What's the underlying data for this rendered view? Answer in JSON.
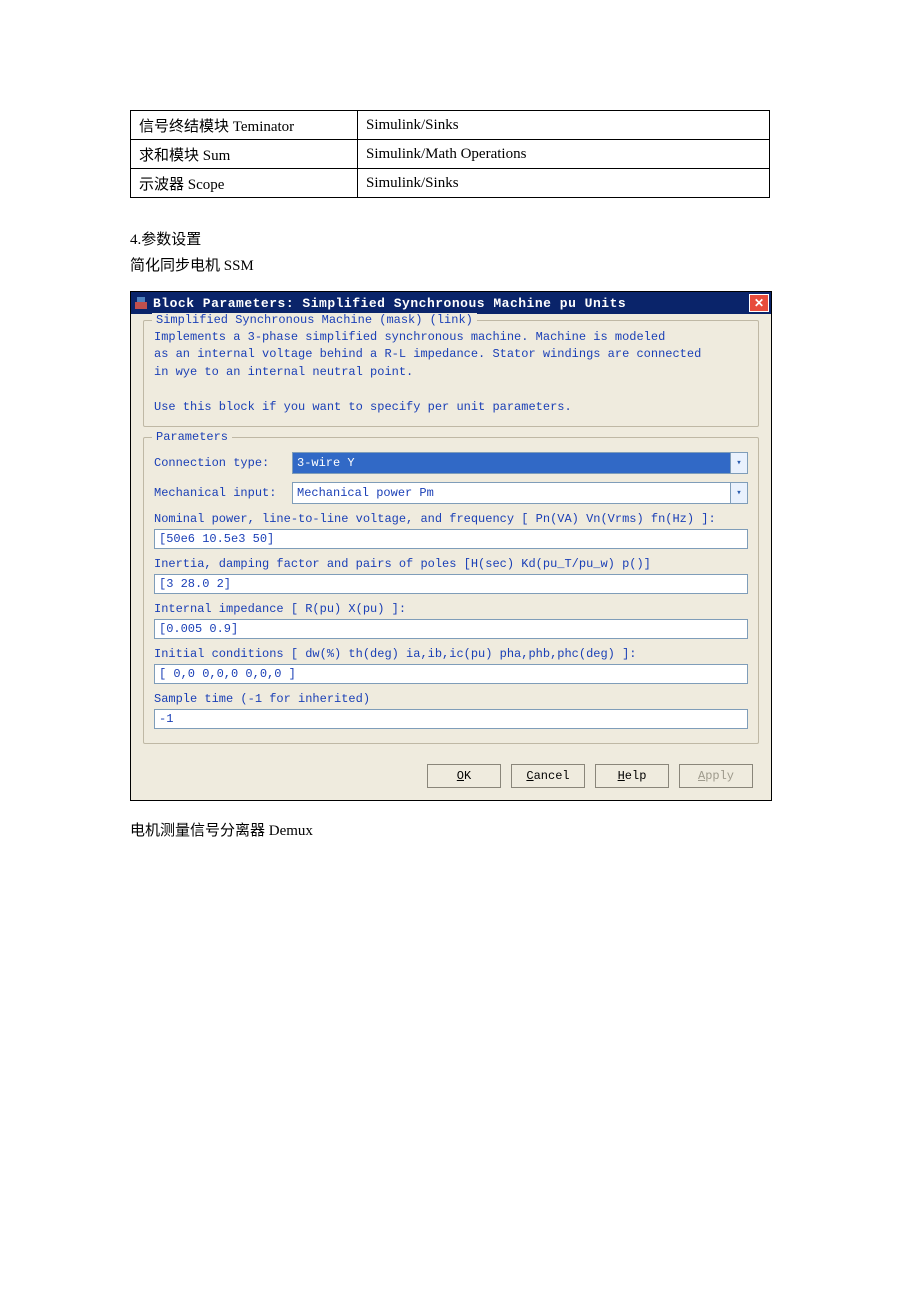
{
  "table": {
    "rows": [
      [
        "信号终结模块 Teminator",
        "Simulink/Sinks"
      ],
      [
        "求和模块 Sum",
        "Simulink/Math Operations"
      ],
      [
        "示波器 Scope",
        "Simulink/Sinks"
      ]
    ]
  },
  "section": {
    "line1": "4.参数设置",
    "line2": "简化同步电机 SSM"
  },
  "dialog": {
    "title": "Block Parameters: Simplified Synchronous Machine pu Units",
    "mask_title": "Simplified Synchronous Machine (mask) (link)",
    "description": "Implements a 3-phase simplified synchronous machine. Machine is modeled\nas an internal voltage behind a R-L impedance. Stator windings are connected\nin wye to an internal neutral point.\n\nUse this block if you want to specify per unit parameters.",
    "params_title": "Parameters",
    "connection": {
      "label": "Connection type:",
      "value": "3-wire Y"
    },
    "mechanical": {
      "label": "Mechanical input:",
      "value": "Mechanical power Pm"
    },
    "nominal": {
      "label": "Nominal power, line-to-line voltage, and frequency [ Pn(VA) Vn(Vrms) fn(Hz) ]:",
      "value": "[50e6 10.5e3 50]"
    },
    "inertia": {
      "label": "Inertia, damping factor and pairs of poles [H(sec) Kd(pu_T/pu_w) p()]",
      "value": "[3 28.0 2]"
    },
    "impedance": {
      "label": "Internal impedance [ R(pu)  X(pu) ]:",
      "value": "[0.005  0.9]"
    },
    "initial": {
      "label": "Initial conditions [ dw(%)  th(deg)  ia,ib,ic(pu)  pha,phb,phc(deg) ]:",
      "value": "[ 0,0   0,0,0   0,0,0 ]"
    },
    "sample": {
      "label": "Sample time (-1 for inherited)",
      "value": "-1"
    },
    "buttons": {
      "ok": "OK",
      "cancel": "Cancel",
      "help": "Help",
      "apply": "Apply"
    }
  },
  "footer": "电机测量信号分离器 Demux"
}
